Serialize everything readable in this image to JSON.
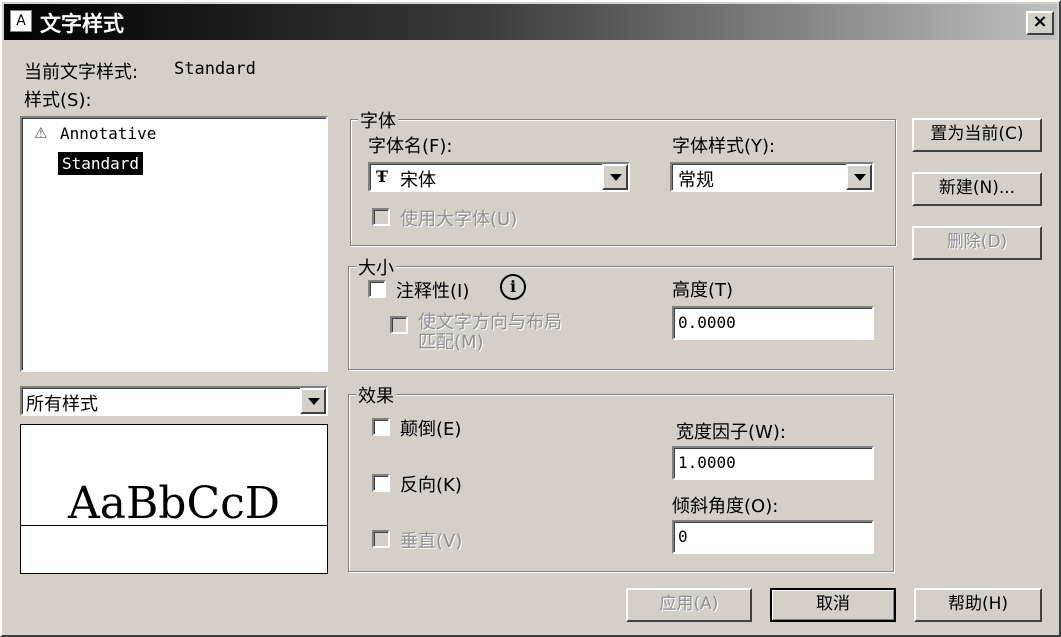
{
  "window": {
    "title": "文字样式",
    "close_label": "×"
  },
  "current_style": {
    "label": "当前文字样式:",
    "value": "Standard"
  },
  "styles": {
    "label": "样式(S):",
    "items": [
      {
        "name": "Annotative",
        "icon": "annotative-icon",
        "selected": false
      },
      {
        "name": "Standard",
        "icon": "",
        "selected": true
      }
    ],
    "filter_value": "所有样式"
  },
  "preview": {
    "text": "AaBbCcD"
  },
  "font": {
    "group_title": "字体",
    "name_label": "字体名(F):",
    "name_value": "宋体",
    "name_icon": "truetype-icon",
    "style_label": "字体样式(Y):",
    "style_value": "常规",
    "bigfont_label": "使用大字体(U)"
  },
  "size": {
    "group_title": "大小",
    "annotative_label": "注释性(I)",
    "info_icon": "info-icon",
    "match_layout_label_1": "使文字方向与布局",
    "match_layout_label_2": "匹配(M)",
    "height_label": "高度(T)",
    "height_value": "0.0000"
  },
  "effects": {
    "group_title": "效果",
    "upside_down_label": "颠倒(E)",
    "backwards_label": "反向(K)",
    "vertical_label": "垂直(V)",
    "width_factor_label": "宽度因子(W):",
    "width_factor_value": "1.0000",
    "oblique_label": "倾斜角度(O):",
    "oblique_value": "0"
  },
  "buttons": {
    "set_current": "置为当前(C)",
    "new": "新建(N)...",
    "delete": "删除(D)",
    "apply": "应用(A)",
    "cancel": "取消",
    "help": "帮助(H)"
  }
}
